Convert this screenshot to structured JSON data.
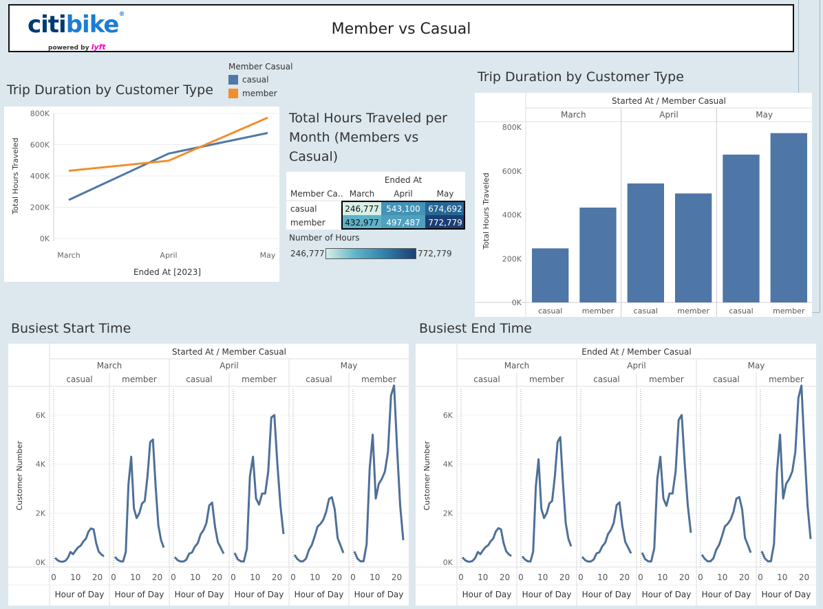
{
  "header": {
    "logo_text_1": "citi",
    "logo_text_2": "bike",
    "logo_reg": "®",
    "powered_by": "powered by",
    "lyft": "lyft",
    "title": "Member vs Casual"
  },
  "colors": {
    "casual": "#4e79a7",
    "member": "#f28e2b",
    "bar": "#4e76a6",
    "line": "#4e6f99",
    "heat_low": "#d7efe6",
    "heat_high": "#1b3f73"
  },
  "legend": {
    "title": "Member Casual",
    "items": [
      {
        "label": "casual",
        "color": "#4e79a7"
      },
      {
        "label": "member",
        "color": "#f28e2b"
      }
    ]
  },
  "line_widget": {
    "title": "Trip Duration by Customer Type"
  },
  "heat_widget": {
    "title_lines": [
      "Total Hours Traveled per",
      "Month (Members vs",
      "Casual)"
    ],
    "scale_title": "Number of Hours",
    "scale_min": "246,777",
    "scale_max": "772,779"
  },
  "bar_widget": {
    "title": "Trip Duration by Customer Type"
  },
  "start_widget": {
    "title": "Busiest Start Time"
  },
  "end_widget": {
    "title": "Busiest End Time"
  },
  "chart_data": [
    {
      "id": "line",
      "type": "line",
      "title": "Trip Duration by Customer Type",
      "xlabel": "Ended At [2023]",
      "ylabel": "Total Hours Traveled",
      "categories": [
        "March",
        "April",
        "May"
      ],
      "ylim": [
        0,
        800000
      ],
      "yticks": [
        0,
        200000,
        400000,
        600000,
        800000
      ],
      "ytick_labels": [
        "0K",
        "200K",
        "400K",
        "600K",
        "800K"
      ],
      "series": [
        {
          "name": "casual",
          "values": [
            246777,
            543100,
            674692
          ]
        },
        {
          "name": "member",
          "values": [
            432977,
            497487,
            772779
          ]
        }
      ],
      "grid": true
    },
    {
      "id": "heatmap",
      "type": "heatmap",
      "title": "Total Hours Traveled per Month (Members vs Casual)",
      "column_header": "Ended At",
      "row_header": "Member Ca..",
      "columns": [
        "March",
        "April",
        "May"
      ],
      "rows": [
        "casual",
        "member"
      ],
      "values": [
        [
          246777,
          543100,
          674692
        ],
        [
          432977,
          497487,
          772779
        ]
      ],
      "labels": [
        [
          "246,777",
          "543,100",
          "674,692"
        ],
        [
          "432,977",
          "497,487",
          "772,779"
        ]
      ]
    },
    {
      "id": "bars",
      "type": "bar",
      "title": "Trip Duration by Customer Type",
      "header": "Started At / Member Casual",
      "ylabel": "Total Hours Traveled",
      "groups": [
        "March",
        "April",
        "May"
      ],
      "categories": [
        "casual",
        "member"
      ],
      "values": [
        [
          246777,
          432977
        ],
        [
          543100,
          497487
        ],
        [
          674692,
          772779
        ]
      ],
      "ylim": [
        0,
        800000
      ],
      "yticks": [
        0,
        200000,
        400000,
        600000,
        800000
      ],
      "ytick_labels": [
        "0K",
        "200K",
        "400K",
        "600K",
        "800K"
      ]
    },
    {
      "id": "start",
      "type": "line",
      "title": "Busiest Start Time",
      "header": "Started At / Member Casual",
      "ylabel": "Customer Number",
      "xlabel": "Hour of Day",
      "ylim": [
        0,
        7200
      ],
      "yticks": [
        0,
        2000,
        4000,
        6000
      ],
      "ytick_labels": [
        "0K",
        "2K",
        "4K",
        "6K"
      ],
      "xticks": [
        0,
        10,
        20
      ],
      "panels": [
        {
          "month": "March",
          "type": "casual",
          "values": [
            180,
            80,
            30,
            20,
            60,
            180,
            420,
            330,
            480,
            610,
            680,
            850,
            960,
            1250,
            1380,
            1340,
            780,
            430,
            320,
            240
          ]
        },
        {
          "month": "March",
          "type": "member",
          "values": [
            220,
            100,
            40,
            30,
            420,
            3200,
            4300,
            2200,
            1800,
            2000,
            2400,
            2500,
            3500,
            4900,
            5000,
            3100,
            1500,
            900,
            600
          ]
        },
        {
          "month": "April",
          "type": "casual",
          "values": [
            210,
            80,
            30,
            30,
            100,
            350,
            400,
            640,
            780,
            1140,
            1310,
            1600,
            2320,
            2430,
            1450,
            820,
            590,
            350
          ]
        },
        {
          "month": "April",
          "type": "member",
          "values": [
            380,
            120,
            40,
            30,
            550,
            3500,
            4300,
            2600,
            2350,
            2800,
            2800,
            3700,
            5900,
            6000,
            4000,
            2300,
            1150
          ]
        },
        {
          "month": "May",
          "type": "casual",
          "values": [
            300,
            130,
            40,
            40,
            150,
            500,
            700,
            1050,
            1450,
            1560,
            1730,
            2050,
            2580,
            2650,
            2150,
            990,
            690,
            380
          ]
        },
        {
          "month": "May",
          "type": "member",
          "values": [
            440,
            150,
            40,
            40,
            730,
            3800,
            5200,
            2600,
            3200,
            3400,
            3700,
            4500,
            6800,
            7200,
            4600,
            2300,
            900
          ]
        }
      ]
    },
    {
      "id": "end",
      "type": "line",
      "title": "Busiest End Time",
      "header": "Ended At / Member Casual",
      "ylabel": "Customer Number",
      "xlabel": "Hour of Day",
      "ylim": [
        0,
        7200
      ],
      "yticks": [
        0,
        2000,
        4000,
        6000
      ],
      "ytick_labels": [
        "0K",
        "2K",
        "4K",
        "6K"
      ],
      "xticks": [
        0,
        10,
        20
      ],
      "panels": [
        {
          "month": "March",
          "type": "casual",
          "values": [
            200,
            90,
            30,
            20,
            60,
            180,
            420,
            330,
            490,
            620,
            690,
            860,
            970,
            1260,
            1390,
            1340,
            790,
            450,
            330,
            250
          ]
        },
        {
          "month": "March",
          "type": "member",
          "values": [
            240,
            110,
            40,
            30,
            430,
            3100,
            4200,
            2200,
            1800,
            2000,
            2400,
            2500,
            3500,
            4900,
            5100,
            3200,
            1600,
            950,
            650
          ]
        },
        {
          "month": "April",
          "type": "casual",
          "values": [
            220,
            90,
            30,
            30,
            110,
            360,
            410,
            650,
            790,
            1150,
            1320,
            1610,
            2330,
            2440,
            1460,
            830,
            600,
            360
          ]
        },
        {
          "month": "April",
          "type": "member",
          "values": [
            390,
            130,
            40,
            30,
            560,
            3400,
            4300,
            2600,
            2300,
            2800,
            2800,
            3700,
            5800,
            6000,
            4000,
            2300,
            1200
          ]
        },
        {
          "month": "May",
          "type": "casual",
          "values": [
            310,
            140,
            40,
            40,
            160,
            510,
            710,
            1060,
            1460,
            1570,
            1740,
            2060,
            2590,
            2660,
            2160,
            1000,
            700,
            390
          ]
        },
        {
          "month": "May",
          "type": "member",
          "values": [
            450,
            160,
            40,
            40,
            740,
            3700,
            5200,
            2600,
            3200,
            3400,
            3700,
            4500,
            6700,
            7200,
            4600,
            2300,
            950
          ]
        }
      ]
    }
  ]
}
